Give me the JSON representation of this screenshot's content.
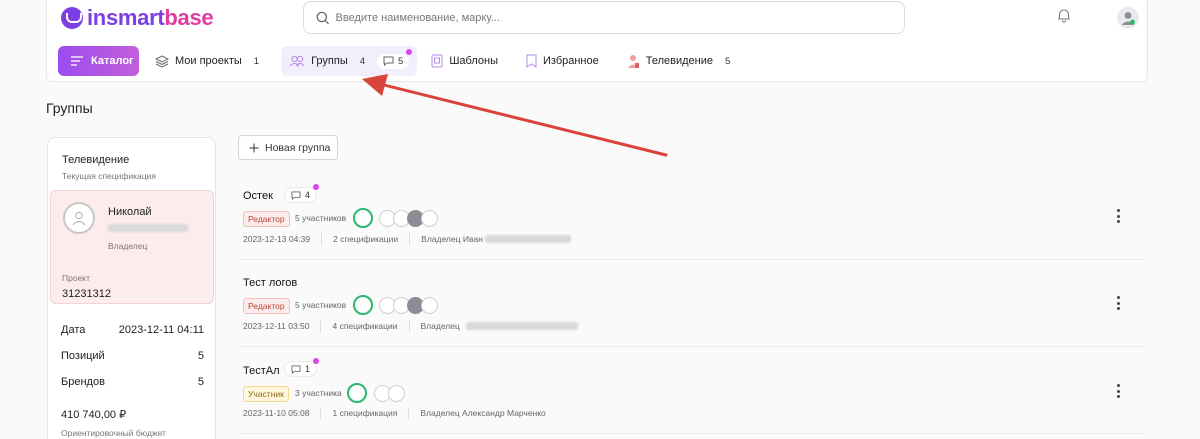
{
  "brand": {
    "logo_text_a": "insmart",
    "logo_text_b": "base"
  },
  "search": {
    "placeholder": "Введите наименование, марку..."
  },
  "nav": {
    "catalog_label": "Каталог",
    "items": [
      {
        "label": "Мои проекты",
        "count": "1"
      },
      {
        "label": "Группы",
        "count": "4",
        "chat_count": "5"
      },
      {
        "label": "Шаблоны"
      },
      {
        "label": "Избранное"
      },
      {
        "label": "Телевидение",
        "count": "5"
      }
    ]
  },
  "page": {
    "title": "Группы"
  },
  "spec_card": {
    "title": "Телевидение",
    "subtitle": "Текущая спецификация",
    "owner_name": "Николай",
    "owner_role": "Владелец",
    "project_label": "Проект",
    "project_value": "31231312",
    "stats": [
      {
        "label": "Дата",
        "value": "2023-12-11 04:11"
      },
      {
        "label": "Позиций",
        "value": "5"
      },
      {
        "label": "Брендов",
        "value": "5"
      }
    ],
    "budget_value": "410 740,00 ₽",
    "budget_label": "Ориентировочный бюджет"
  },
  "new_group_label": "Новая группа",
  "groups": [
    {
      "name": "Остек",
      "chat_count": "4",
      "role": "Редактор",
      "members": "5 участников",
      "date": "2023-12-13 04:39",
      "specs": "2 спецификации",
      "owner": "Владелец Иван"
    },
    {
      "name": "Тест логов",
      "role": "Редактор",
      "members": "5 участников",
      "date": "2023-12-11 03:50",
      "specs": "4 спецификации",
      "owner": "Владелец"
    },
    {
      "name": "ТестАл",
      "chat_count": "1",
      "role": "Участник",
      "members": "3 участника",
      "date": "2023-11-10 05:08",
      "specs": "1 спецификация",
      "owner": "Владелец Александр Марченко"
    }
  ],
  "colors": {
    "accent": "#9b4df0",
    "annotation_arrow": "#d9443a",
    "editor_tag": "#fdecec",
    "member_tag": "#fff6db",
    "online_ring": "#2bb673"
  }
}
